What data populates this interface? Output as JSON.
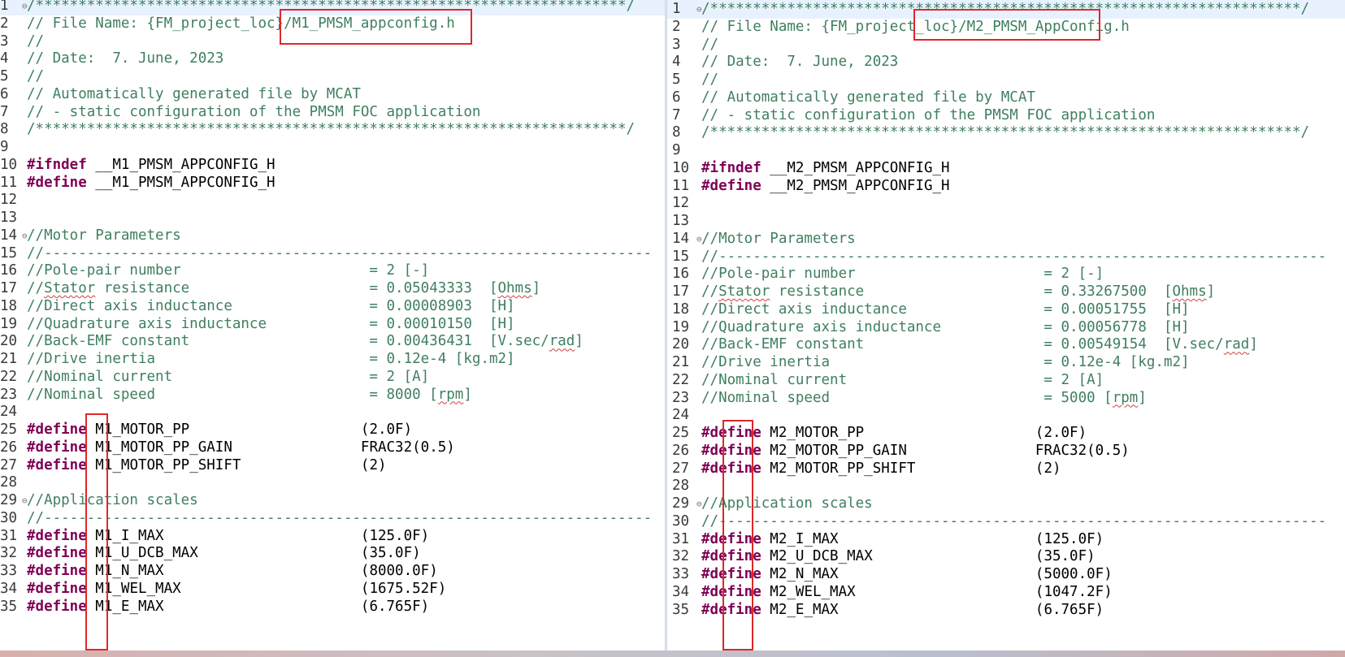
{
  "left": {
    "lines": [
      {
        "n": "1",
        "fold": "⊖",
        "segs": [
          {
            "c": "c",
            "t": "/*********************************************************************/"
          }
        ]
      },
      {
        "n": "2",
        "segs": [
          {
            "c": "c",
            "t": "// File Name: {FM_project_loc}/M1_PMSM_appconfig.h"
          }
        ]
      },
      {
        "n": "3",
        "segs": [
          {
            "c": "c",
            "t": "//"
          }
        ]
      },
      {
        "n": "4",
        "segs": [
          {
            "c": "c",
            "t": "// Date:  7. June, 2023"
          }
        ]
      },
      {
        "n": "5",
        "segs": [
          {
            "c": "c",
            "t": "//"
          }
        ]
      },
      {
        "n": "6",
        "segs": [
          {
            "c": "c",
            "t": "// Automatically generated file by MCAT"
          }
        ]
      },
      {
        "n": "7",
        "segs": [
          {
            "c": "c",
            "t": "// - static configuration of the PMSM FOC application"
          }
        ]
      },
      {
        "n": "8",
        "segs": [
          {
            "c": "c",
            "t": "/*********************************************************************/"
          }
        ]
      },
      {
        "n": "9",
        "segs": []
      },
      {
        "n": "10",
        "segs": [
          {
            "c": "k",
            "t": "#ifndef"
          },
          {
            "c": "t",
            "t": " __M1_PMSM_APPCONFIG_H"
          }
        ]
      },
      {
        "n": "11",
        "segs": [
          {
            "c": "k",
            "t": "#define"
          },
          {
            "c": "t",
            "t": " __M1_PMSM_APPCONFIG_H"
          }
        ]
      },
      {
        "n": "12",
        "segs": []
      },
      {
        "n": "13",
        "segs": []
      },
      {
        "n": "14",
        "fold": "⊖",
        "segs": [
          {
            "c": "c",
            "t": "//Motor Parameters"
          }
        ]
      },
      {
        "n": "15",
        "segs": [
          {
            "c": "c",
            "t": "//-----------------------------------------------------------------------"
          }
        ]
      },
      {
        "n": "16",
        "segs": [
          {
            "c": "c",
            "t": "//Pole-pair number                      = 2 [-]"
          }
        ]
      },
      {
        "n": "17",
        "segs": [
          {
            "c": "c",
            "t": "//"
          },
          {
            "c": "c u",
            "t": "Stator"
          },
          {
            "c": "c",
            "t": " resistance                     = 0.05043333  ["
          },
          {
            "c": "c u",
            "t": "Ohms"
          },
          {
            "c": "c",
            "t": "]"
          }
        ]
      },
      {
        "n": "18",
        "segs": [
          {
            "c": "c",
            "t": "//Direct axis inductance                = 0.00008903  [H]"
          }
        ]
      },
      {
        "n": "19",
        "segs": [
          {
            "c": "c",
            "t": "//Quadrature axis inductance            = 0.00010150  [H]"
          }
        ]
      },
      {
        "n": "20",
        "segs": [
          {
            "c": "c",
            "t": "//Back-EMF constant                     = 0.00436431  [V.sec/"
          },
          {
            "c": "c u",
            "t": "rad"
          },
          {
            "c": "c",
            "t": "]"
          }
        ]
      },
      {
        "n": "21",
        "segs": [
          {
            "c": "c",
            "t": "//Drive inertia                         = 0.12e-4 [kg.m2]"
          }
        ]
      },
      {
        "n": "22",
        "segs": [
          {
            "c": "c",
            "t": "//Nominal current                       = 2 [A]"
          }
        ]
      },
      {
        "n": "23",
        "segs": [
          {
            "c": "c",
            "t": "//Nominal speed                         = 8000 ["
          },
          {
            "c": "c u",
            "t": "rpm"
          },
          {
            "c": "c",
            "t": "]"
          }
        ]
      },
      {
        "n": "24",
        "segs": []
      },
      {
        "n": "25",
        "segs": [
          {
            "c": "k",
            "t": "#define"
          },
          {
            "c": "t",
            "t": " M1_MOTOR_PP                    (2.0F)"
          }
        ]
      },
      {
        "n": "26",
        "segs": [
          {
            "c": "k",
            "t": "#define"
          },
          {
            "c": "t",
            "t": " M1_MOTOR_PP_GAIN               FRAC32(0.5)"
          }
        ]
      },
      {
        "n": "27",
        "segs": [
          {
            "c": "k",
            "t": "#define"
          },
          {
            "c": "t",
            "t": " M1_MOTOR_PP_SHIFT              (2)"
          }
        ]
      },
      {
        "n": "28",
        "segs": []
      },
      {
        "n": "29",
        "fold": "⊖",
        "segs": [
          {
            "c": "c",
            "t": "//Application scales"
          }
        ]
      },
      {
        "n": "30",
        "segs": [
          {
            "c": "c",
            "t": "//-----------------------------------------------------------------------"
          }
        ]
      },
      {
        "n": "31",
        "segs": [
          {
            "c": "k",
            "t": "#define"
          },
          {
            "c": "t",
            "t": " M1_I_MAX                       (125.0F)"
          }
        ]
      },
      {
        "n": "32",
        "segs": [
          {
            "c": "k",
            "t": "#define"
          },
          {
            "c": "t",
            "t": " M1_U_DCB_MAX                   (35.0F)"
          }
        ]
      },
      {
        "n": "33",
        "segs": [
          {
            "c": "k",
            "t": "#define"
          },
          {
            "c": "t",
            "t": " M1_N_MAX                       (8000.0F)"
          }
        ]
      },
      {
        "n": "34",
        "segs": [
          {
            "c": "k",
            "t": "#define"
          },
          {
            "c": "t",
            "t": " M1_WEL_MAX                     (1675.52F)"
          }
        ]
      },
      {
        "n": "35",
        "segs": [
          {
            "c": "k",
            "t": "#define"
          },
          {
            "c": "t",
            "t": " M1_E_MAX                       (6.765F)"
          }
        ]
      }
    ]
  },
  "right": {
    "lines": [
      {
        "n": "1",
        "fold": "⊖",
        "segs": [
          {
            "c": "c",
            "t": "/*********************************************************************/"
          }
        ]
      },
      {
        "n": "2",
        "segs": [
          {
            "c": "c",
            "t": "// File Name: {FM_project_loc}/M2_PMSM_AppConfig.h"
          }
        ]
      },
      {
        "n": "3",
        "segs": [
          {
            "c": "c",
            "t": "//"
          }
        ]
      },
      {
        "n": "4",
        "segs": [
          {
            "c": "c",
            "t": "// Date:  7. June, 2023"
          }
        ]
      },
      {
        "n": "5",
        "segs": [
          {
            "c": "c",
            "t": "//"
          }
        ]
      },
      {
        "n": "6",
        "segs": [
          {
            "c": "c",
            "t": "// Automatically generated file by MCAT"
          }
        ]
      },
      {
        "n": "7",
        "segs": [
          {
            "c": "c",
            "t": "// - static configuration of the PMSM FOC application"
          }
        ]
      },
      {
        "n": "8",
        "segs": [
          {
            "c": "c",
            "t": "/*********************************************************************/"
          }
        ]
      },
      {
        "n": "9",
        "segs": []
      },
      {
        "n": "10",
        "segs": [
          {
            "c": "k",
            "t": "#ifndef"
          },
          {
            "c": "t",
            "t": " __M2_PMSM_APPCONFIG_H"
          }
        ]
      },
      {
        "n": "11",
        "segs": [
          {
            "c": "k",
            "t": "#define"
          },
          {
            "c": "t",
            "t": " __M2_PMSM_APPCONFIG_H"
          }
        ]
      },
      {
        "n": "12",
        "segs": []
      },
      {
        "n": "13",
        "segs": []
      },
      {
        "n": "14",
        "fold": "⊖",
        "segs": [
          {
            "c": "c",
            "t": "//Motor Parameters"
          }
        ]
      },
      {
        "n": "15",
        "segs": [
          {
            "c": "c",
            "t": "//-----------------------------------------------------------------------"
          }
        ]
      },
      {
        "n": "16",
        "segs": [
          {
            "c": "c",
            "t": "//Pole-pair number                      = 2 [-]"
          }
        ]
      },
      {
        "n": "17",
        "segs": [
          {
            "c": "c",
            "t": "//"
          },
          {
            "c": "c u",
            "t": "Stator"
          },
          {
            "c": "c",
            "t": " resistance                     = 0.33267500  ["
          },
          {
            "c": "c u",
            "t": "Ohms"
          },
          {
            "c": "c",
            "t": "]"
          }
        ]
      },
      {
        "n": "18",
        "segs": [
          {
            "c": "c",
            "t": "//Direct axis inductance                = 0.00051755  [H]"
          }
        ]
      },
      {
        "n": "19",
        "segs": [
          {
            "c": "c",
            "t": "//Quadrature axis inductance            = 0.00056778  [H]"
          }
        ]
      },
      {
        "n": "20",
        "segs": [
          {
            "c": "c",
            "t": "//Back-EMF constant                     = 0.00549154  [V.sec/"
          },
          {
            "c": "c u",
            "t": "rad"
          },
          {
            "c": "c",
            "t": "]"
          }
        ]
      },
      {
        "n": "21",
        "segs": [
          {
            "c": "c",
            "t": "//Drive inertia                         = 0.12e-4 [kg.m2]"
          }
        ]
      },
      {
        "n": "22",
        "segs": [
          {
            "c": "c",
            "t": "//Nominal current                       = 2 [A]"
          }
        ]
      },
      {
        "n": "23",
        "segs": [
          {
            "c": "c",
            "t": "//Nominal speed                         = 5000 ["
          },
          {
            "c": "c u",
            "t": "rpm"
          },
          {
            "c": "c",
            "t": "]"
          }
        ]
      },
      {
        "n": "24",
        "segs": []
      },
      {
        "n": "25",
        "segs": [
          {
            "c": "k",
            "t": "#define"
          },
          {
            "c": "t",
            "t": " M2_MOTOR_PP                    (2.0F)"
          }
        ]
      },
      {
        "n": "26",
        "segs": [
          {
            "c": "k",
            "t": "#define"
          },
          {
            "c": "t",
            "t": " M2_MOTOR_PP_GAIN               FRAC32(0.5)"
          }
        ]
      },
      {
        "n": "27",
        "segs": [
          {
            "c": "k",
            "t": "#define"
          },
          {
            "c": "t",
            "t": " M2_MOTOR_PP_SHIFT              (2)"
          }
        ]
      },
      {
        "n": "28",
        "segs": []
      },
      {
        "n": "29",
        "fold": "⊖",
        "segs": [
          {
            "c": "c",
            "t": "//Application scales"
          }
        ]
      },
      {
        "n": "30",
        "segs": [
          {
            "c": "c",
            "t": "//-----------------------------------------------------------------------"
          }
        ]
      },
      {
        "n": "31",
        "segs": [
          {
            "c": "k",
            "t": "#define"
          },
          {
            "c": "t",
            "t": " M2_I_MAX                       (125.0F)"
          }
        ]
      },
      {
        "n": "32",
        "segs": [
          {
            "c": "k",
            "t": "#define"
          },
          {
            "c": "t",
            "t": " M2_U_DCB_MAX                   (35.0F)"
          }
        ]
      },
      {
        "n": "33",
        "segs": [
          {
            "c": "k",
            "t": "#define"
          },
          {
            "c": "t",
            "t": " M2_N_MAX                       (5000.0F)"
          }
        ]
      },
      {
        "n": "34",
        "segs": [
          {
            "c": "k",
            "t": "#define"
          },
          {
            "c": "t",
            "t": " M2_WEL_MAX                     (1047.2F)"
          }
        ]
      },
      {
        "n": "35",
        "segs": [
          {
            "c": "k",
            "t": "#define"
          },
          {
            "c": "t",
            "t": " M2_E_MAX                       (6.765F)"
          }
        ]
      }
    ]
  },
  "colors": {
    "comment": "#3f7f5f",
    "keyword": "#7f0055",
    "highlight_box": "#e0262b",
    "current_line": "#e8f2fe"
  }
}
